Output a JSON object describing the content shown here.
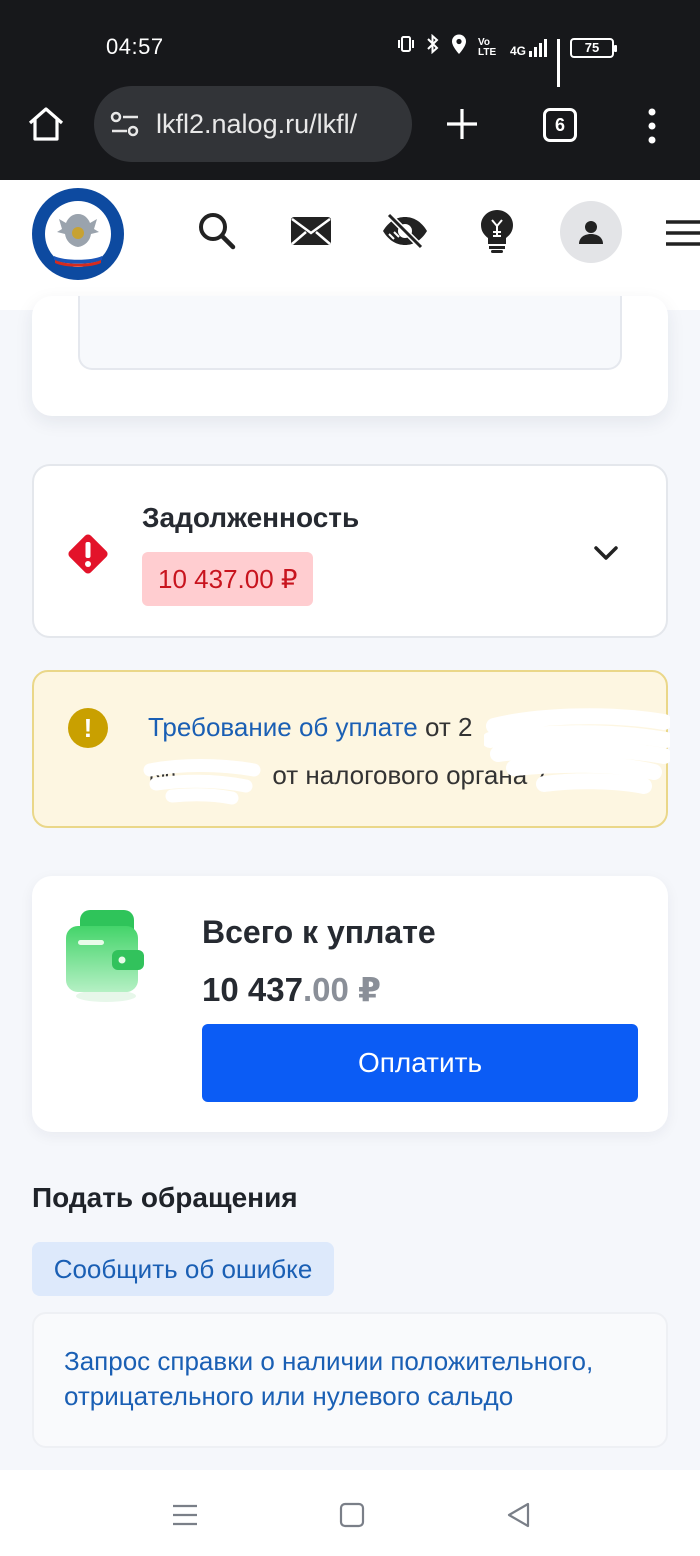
{
  "status_bar": {
    "time": "04:57",
    "battery": "75",
    "volte": "Vo LTE",
    "network": "4G"
  },
  "browser": {
    "url": "lkfl2.nalog.ru/lkfl/",
    "tab_count": "6"
  },
  "site": {
    "logo_text": "ФЕДЕРАЛЬНАЯ НАЛОГОВАЯ СЛУЖБА"
  },
  "debt": {
    "title": "Задолженность",
    "amount": "10 437.00 ₽"
  },
  "notice": {
    "link_text": "Требование об уплате",
    "line1_rest": " от 2",
    "line2_prefix": "№",
    "line2_rest": "от налогового органа 7"
  },
  "payment": {
    "title": "Всего к уплате",
    "amount_int": "10 437",
    "amount_dec": ".00 ₽",
    "button_label": "Оплатить"
  },
  "appeals": {
    "title": "Подать обращения",
    "report_error": "Сообщить об ошибке",
    "request_text": "Запрос справки о наличии положительного, отрицательного или нулевого сальдо"
  },
  "colors": {
    "primary_button": "#0b5cf5",
    "link": "#1a5fb4",
    "debt_badge_bg": "#ffcdd0",
    "debt_badge_text": "#c8141e",
    "notice_bg": "#fdf6e1",
    "warning_red": "#e3132a"
  }
}
